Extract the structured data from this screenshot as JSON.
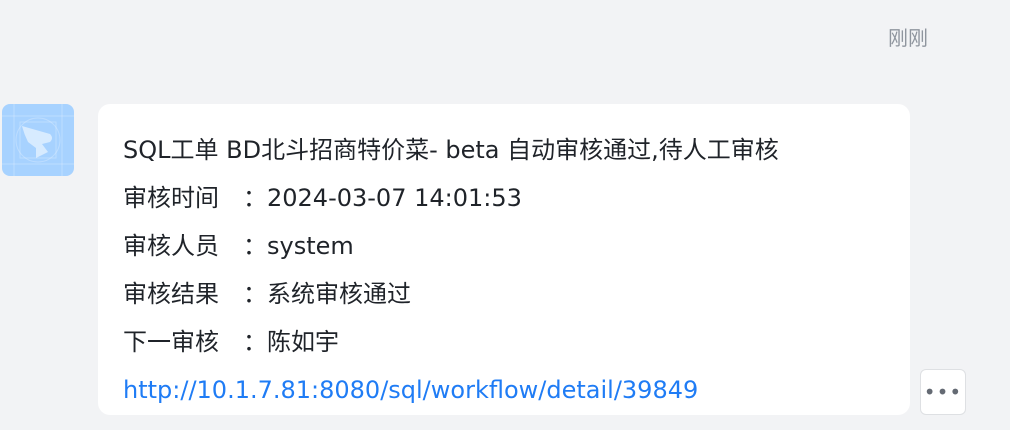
{
  "timestamp": "刚刚",
  "avatar": {
    "icon": "bot-logo-icon",
    "bg_color": "#a7d2ff"
  },
  "message": {
    "title": "SQL工单 BD北斗招商特价菜- beta 自动审核通过,待人工审核",
    "fields": [
      {
        "label": "审核时间",
        "value": "：2024-03-07 14:01:53"
      },
      {
        "label": "审核人员",
        "value": "：system"
      },
      {
        "label": "审核结果",
        "value": "：系统审核通过"
      },
      {
        "label": "下一审核",
        "value": "：陈如宇"
      }
    ],
    "link": "http://10.1.7.81:8080/sql/workflow/detail/39849",
    "link_color": "#1f7cf5"
  },
  "more_button": {
    "icon": "more-horizontal-icon",
    "glyph": "•••"
  }
}
